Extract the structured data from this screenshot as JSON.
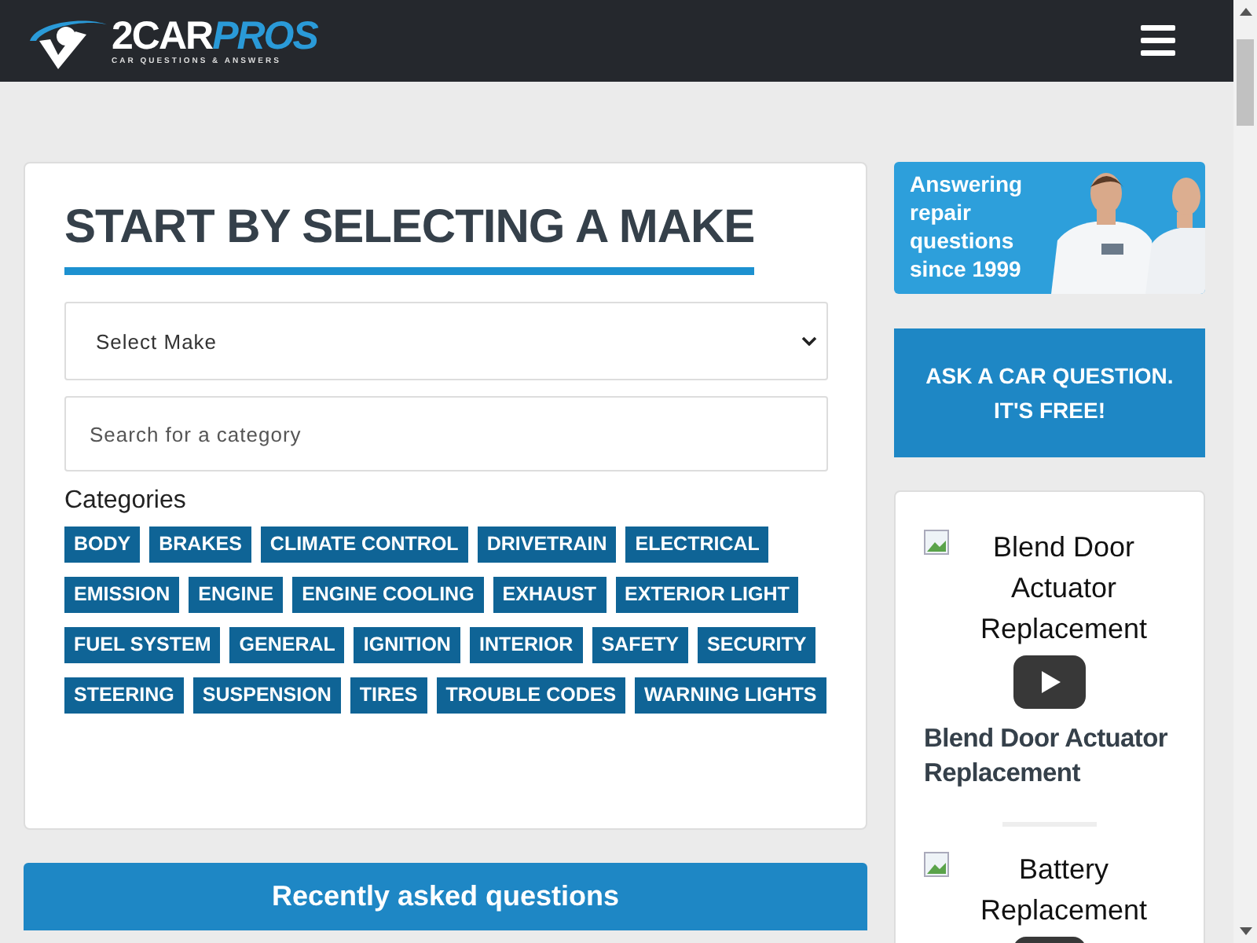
{
  "header": {
    "logo": {
      "brand_first": "2CAR",
      "brand_second": "PROS",
      "tagline": "CAR QUESTIONS & ANSWERS"
    }
  },
  "make_card": {
    "title": "START BY SELECTING A MAKE",
    "make_select": {
      "value": "Select Make"
    },
    "category_search": {
      "placeholder": "Search for a category"
    },
    "categories_label": "Categories",
    "categories": [
      "BODY",
      "BRAKES",
      "CLIMATE CONTROL",
      "DRIVETRAIN",
      "ELECTRICAL",
      "EMISSION",
      "ENGINE",
      "ENGINE COOLING",
      "EXHAUST",
      "EXTERIOR LIGHT",
      "FUEL SYSTEM",
      "GENERAL",
      "IGNITION",
      "INTERIOR",
      "SAFETY",
      "SECURITY",
      "STEERING",
      "SUSPENSION",
      "TIRES",
      "TROUBLE CODES",
      "WARNING LIGHTS"
    ]
  },
  "recent": {
    "title": "Recently asked questions"
  },
  "sidebar": {
    "banner": {
      "kind": "picture",
      "text": "Answering repair questions since 1999"
    },
    "ask_button": "ASK A CAR QUESTION. IT'S FREE!",
    "videos": [
      {
        "alt": "Blend Door Actuator Replacement",
        "title": "Blend Door Actuator Replacement"
      },
      {
        "alt": "Battery Replacement"
      }
    ]
  }
}
